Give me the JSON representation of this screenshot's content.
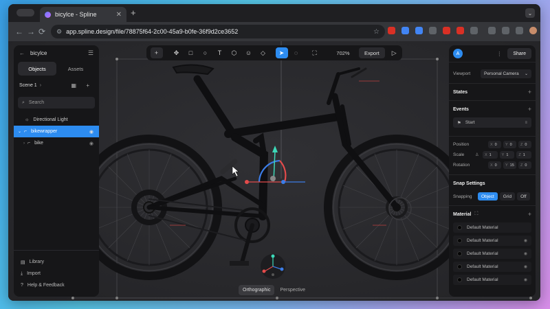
{
  "browser": {
    "tab_title": "bicylce - Spline",
    "tab_close": "✕",
    "new_tab": "+",
    "menu": "⌄",
    "back": "←",
    "forward": "→",
    "reload": "⟳",
    "url": "app.spline.design/file/78875f64-2c00-45a9-b0fe-36f9d2ce3652",
    "site_info": "⚙",
    "bookmark": "☆"
  },
  "left_panel": {
    "back": "←",
    "file_name": "bicylce",
    "menu": "☰",
    "tabs": [
      {
        "label": "Objects",
        "active": true
      },
      {
        "label": "Assets",
        "active": false
      }
    ],
    "scene_label": "Scene 1",
    "scene_chevron": "›",
    "scene_icons": "▦ +",
    "search_icon": "⌕",
    "search_placeholder": "Search",
    "tree": [
      {
        "label": "Directional Light",
        "icon": "☼",
        "selected": false,
        "indent": 16,
        "eye": ""
      },
      {
        "label": "bikewrapper",
        "icon": "⌐",
        "selected": true,
        "indent": 6,
        "eye": "◉",
        "chevron": "⌄"
      },
      {
        "label": "bike",
        "icon": "⌐",
        "selected": false,
        "indent": 14,
        "eye": "◉",
        "chevron": "›"
      }
    ],
    "bottom": [
      {
        "label": "Library",
        "icon": "▤"
      },
      {
        "label": "Import",
        "icon": "⤓"
      },
      {
        "label": "Help & Feedback",
        "icon": "?"
      }
    ]
  },
  "toolbar": {
    "tools": [
      {
        "name": "add-button",
        "glyph": "+",
        "cls": "plus"
      },
      {
        "name": "transform-tool",
        "glyph": "✥",
        "cls": ""
      },
      {
        "name": "rectangle-tool",
        "glyph": "□",
        "cls": ""
      },
      {
        "name": "ellipse-tool",
        "glyph": "○",
        "cls": ""
      },
      {
        "name": "text-tool",
        "glyph": "T",
        "cls": ""
      },
      {
        "name": "shape-tool",
        "glyph": "⬡",
        "cls": ""
      },
      {
        "name": "emoji-tool",
        "glyph": "☺",
        "cls": ""
      },
      {
        "name": "paint-tool",
        "glyph": "◇",
        "cls": ""
      },
      {
        "name": "select-tool",
        "glyph": "➤",
        "cls": "active"
      },
      {
        "name": "comment-tool",
        "glyph": "◌",
        "cls": ""
      },
      {
        "name": "frame-tool",
        "glyph": "⛶",
        "cls": ""
      }
    ],
    "zoom": "702%",
    "export_label": "Export",
    "play": "▷"
  },
  "right_panel": {
    "avatar": "A",
    "more": "⋮",
    "share_label": "Share",
    "viewport_label": "Viewport",
    "viewport_value": "Personal Camera",
    "states_label": "States",
    "events_label": "Events",
    "event_item": "Start",
    "event_icon": "⚑",
    "event_ctrl": "≡",
    "add": "+",
    "chevron": "⌄",
    "transform": [
      {
        "label": "Position",
        "lock": "",
        "values": [
          [
            "X",
            "0"
          ],
          [
            "Y",
            "0"
          ],
          [
            "Z",
            "0"
          ]
        ]
      },
      {
        "label": "Scale",
        "lock": "♙",
        "values": [
          [
            "X",
            "1"
          ],
          [
            "Y",
            "1"
          ],
          [
            "Z",
            "1"
          ]
        ]
      },
      {
        "label": "Rotation",
        "lock": "",
        "values": [
          [
            "X",
            "0"
          ],
          [
            "Y",
            "15"
          ],
          [
            "Z",
            "0"
          ]
        ]
      }
    ],
    "snap_title": "Snap Settings",
    "snapping_label": "Snapping",
    "snap_options": [
      {
        "label": "Object",
        "active": true
      },
      {
        "label": "Grid",
        "active": false
      },
      {
        "label": "Off",
        "active": false
      }
    ],
    "material_title": "Material",
    "material_expand": "⛶",
    "materials": [
      "Default Material",
      "Default Material",
      "Default Material",
      "Default Material",
      "Default Material"
    ],
    "eye": "◉"
  },
  "view_buttons": [
    {
      "label": "Orthographic",
      "active": true
    },
    {
      "label": "Perspective",
      "active": false
    }
  ],
  "colors": {
    "accent": "#2d8cf0",
    "gizmo_red": "#e34b4b",
    "gizmo_green": "#3dd9b8",
    "gizmo_blue": "#3c7de8"
  }
}
